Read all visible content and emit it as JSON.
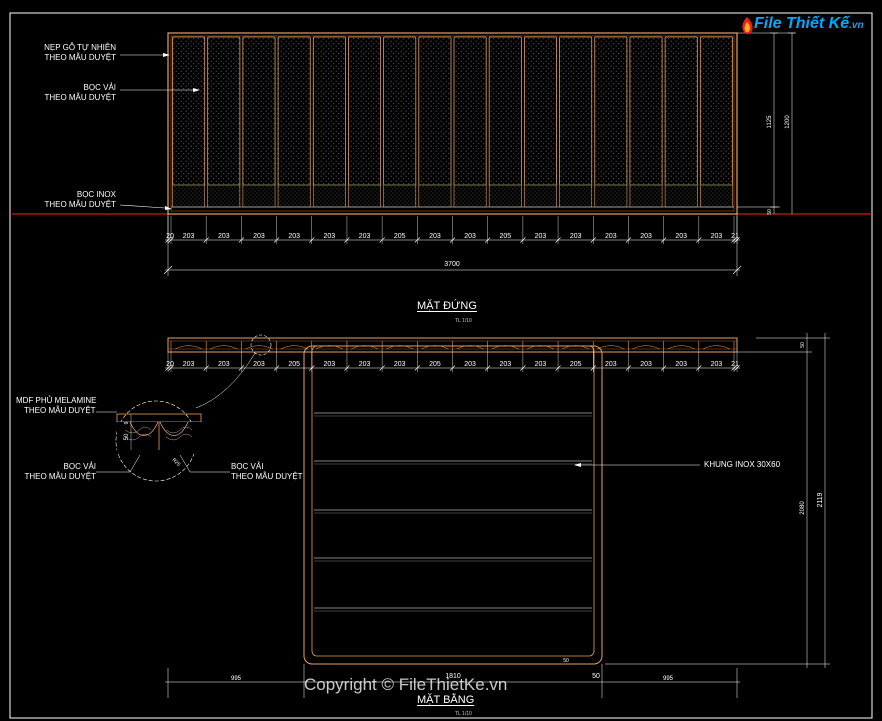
{
  "logo": {
    "text": "File Thiết Kế",
    "suffix": ".vn"
  },
  "elevation": {
    "labels": {
      "wood_strip": [
        "NẸP GỖ TỰ NHIÊN",
        "THEO MẪU DUYỆT"
      ],
      "fabric": [
        "BỌC VẢI",
        "THEO MẪU DUYỆT"
      ],
      "inox": [
        "BỌC INOX",
        "THEO MẪU DUYỆT"
      ]
    },
    "module_dims": [
      "20",
      "203",
      "203",
      "203",
      "203",
      "203",
      "203",
      "205",
      "203",
      "203",
      "205",
      "203",
      "203",
      "203",
      "203",
      "203",
      "203",
      "21"
    ],
    "total_width": "3700",
    "side_dims": {
      "upper": "1125",
      "total": "1200",
      "base": "50"
    },
    "title": "MẶT ĐỨNG",
    "scale": "TL 1/10"
  },
  "plan": {
    "module_dims": [
      "20",
      "203",
      "203",
      "203",
      "205",
      "203",
      "203",
      "203",
      "205",
      "203",
      "203",
      "203",
      "205",
      "203",
      "203",
      "203",
      "203",
      "21"
    ],
    "labels": {
      "mdf": [
        "MDF PHỦ MELAMINE",
        "THEO MẪU DUYỆT"
      ],
      "fabric_left": [
        "BỌC VẢI",
        "THEO MẪU DUYỆT"
      ],
      "fabric_right": [
        "BỌC VẢI",
        "THEO MẪU DUYỆT"
      ],
      "inox_frame": "KHUNG INOX 30X60"
    },
    "detail_dims": {
      "a": "9",
      "b": "50",
      "c": "R25"
    },
    "side_dims": {
      "top": "50",
      "inner": "2080",
      "total": "2119"
    },
    "bottom_dims": {
      "left": "995",
      "inner": "1810",
      "right_a": "50",
      "right": "995",
      "corner": "50"
    },
    "title": "MẶT BẰNG",
    "scale": "TL 1/10"
  },
  "watermark": "Copyright © FileThietKe.vn",
  "colors": {
    "frame": "#e8a060",
    "dim": "#ffffff",
    "ground": "#ff2020",
    "fabric": "#7a7a8a",
    "inox": "#b0b0b0"
  }
}
